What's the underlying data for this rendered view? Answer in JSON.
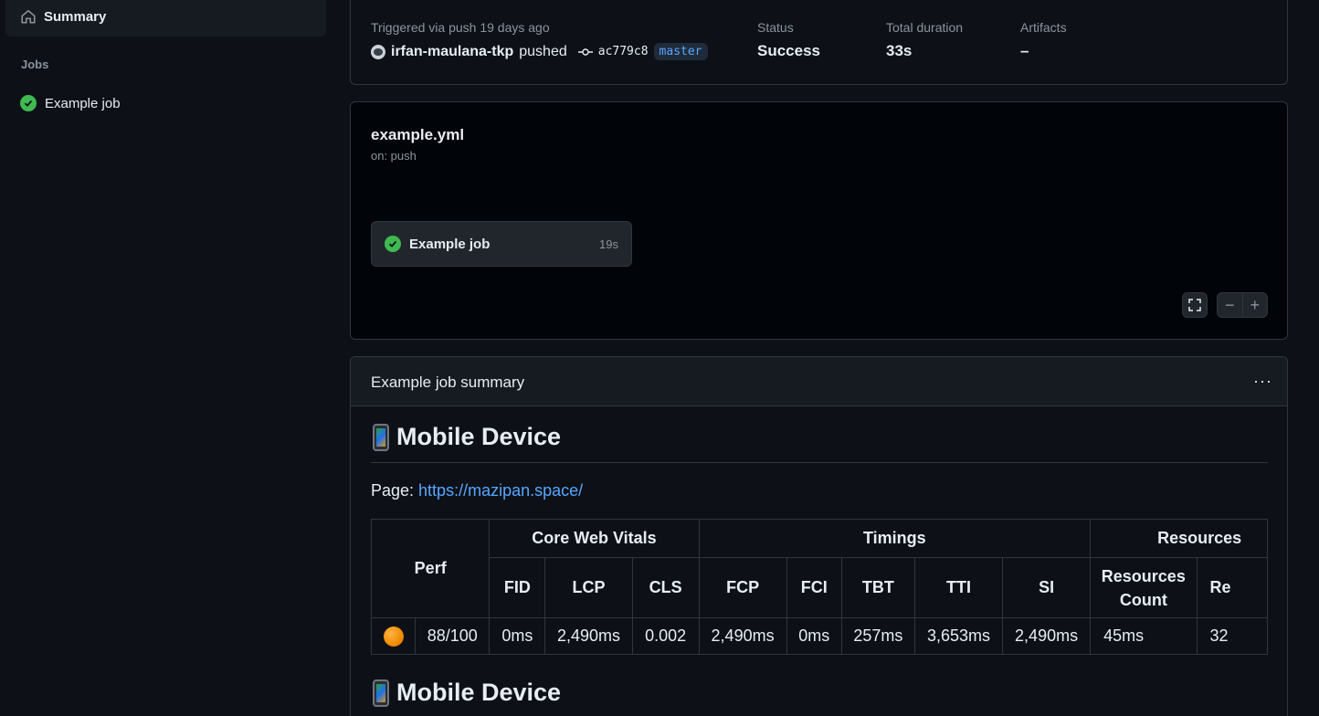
{
  "sidebar": {
    "summary_label": "Summary",
    "jobs_heading": "Jobs",
    "jobs": [
      {
        "label": "Example job",
        "status": "success"
      }
    ]
  },
  "run": {
    "trigger_label": "Triggered via push 19 days ago",
    "actor": "irfan-maulana-tkp",
    "action": "pushed",
    "commit_sha": "ac779c8",
    "branch": "master",
    "status_label": "Status",
    "status_value": "Success",
    "duration_label": "Total duration",
    "duration_value": "33s",
    "artifacts_label": "Artifacts",
    "artifacts_value": "–"
  },
  "workflow": {
    "file": "example.yml",
    "trigger": "on: push",
    "job": {
      "name": "Example job",
      "duration": "19s"
    },
    "zoom_out_label": "−",
    "zoom_in_label": "+"
  },
  "summary": {
    "title": "Example job summary",
    "menu_label": "···",
    "sections": [
      {
        "heading": "Mobile Device",
        "page_label": "Page: ",
        "page_url": "https://mazipan.space/",
        "group_headers": [
          "Perf",
          "Core Web Vitals",
          "Timings",
          "Resources"
        ],
        "columns": [
          "FID",
          "LCP",
          "CLS",
          "FCP",
          "FCI",
          "TBT",
          "TTI",
          "SI",
          "Resources Count",
          "Re"
        ],
        "row": {
          "perf_icon": "orange-circle",
          "perf": "88/100",
          "values": [
            "0ms",
            "2,490ms",
            "0.002",
            "2,490ms",
            "0ms",
            "257ms",
            "3,653ms",
            "2,490ms",
            "45ms",
            "32"
          ]
        }
      },
      {
        "heading": "Mobile Device"
      }
    ]
  },
  "colors": {
    "background": "#0d1117",
    "panel": "#161b22",
    "border": "#30363d",
    "accent": "#58a6ff",
    "success": "#3fb950"
  }
}
